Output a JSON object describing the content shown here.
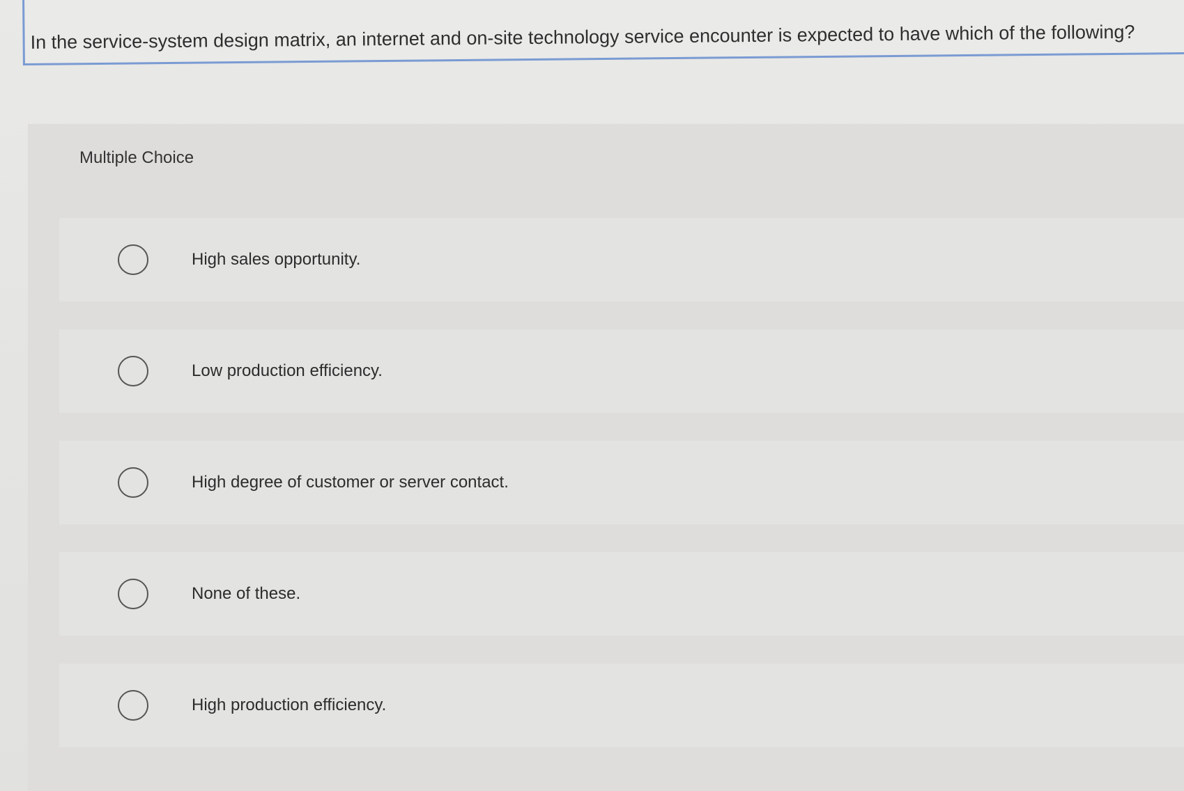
{
  "question": {
    "text": "In the service-system design matrix, an internet and on-site technology service encounter is expected to have which of the following?"
  },
  "multiple_choice": {
    "heading": "Multiple Choice",
    "options": [
      {
        "label": "High sales opportunity.",
        "selected": false
      },
      {
        "label": "Low production efficiency.",
        "selected": false
      },
      {
        "label": "High degree of customer or server contact.",
        "selected": false
      },
      {
        "label": "None of these.",
        "selected": false
      },
      {
        "label": "High production efficiency.",
        "selected": false
      }
    ]
  },
  "colors": {
    "question_border": "#7a9bd3",
    "background": "#e6e6e4"
  }
}
